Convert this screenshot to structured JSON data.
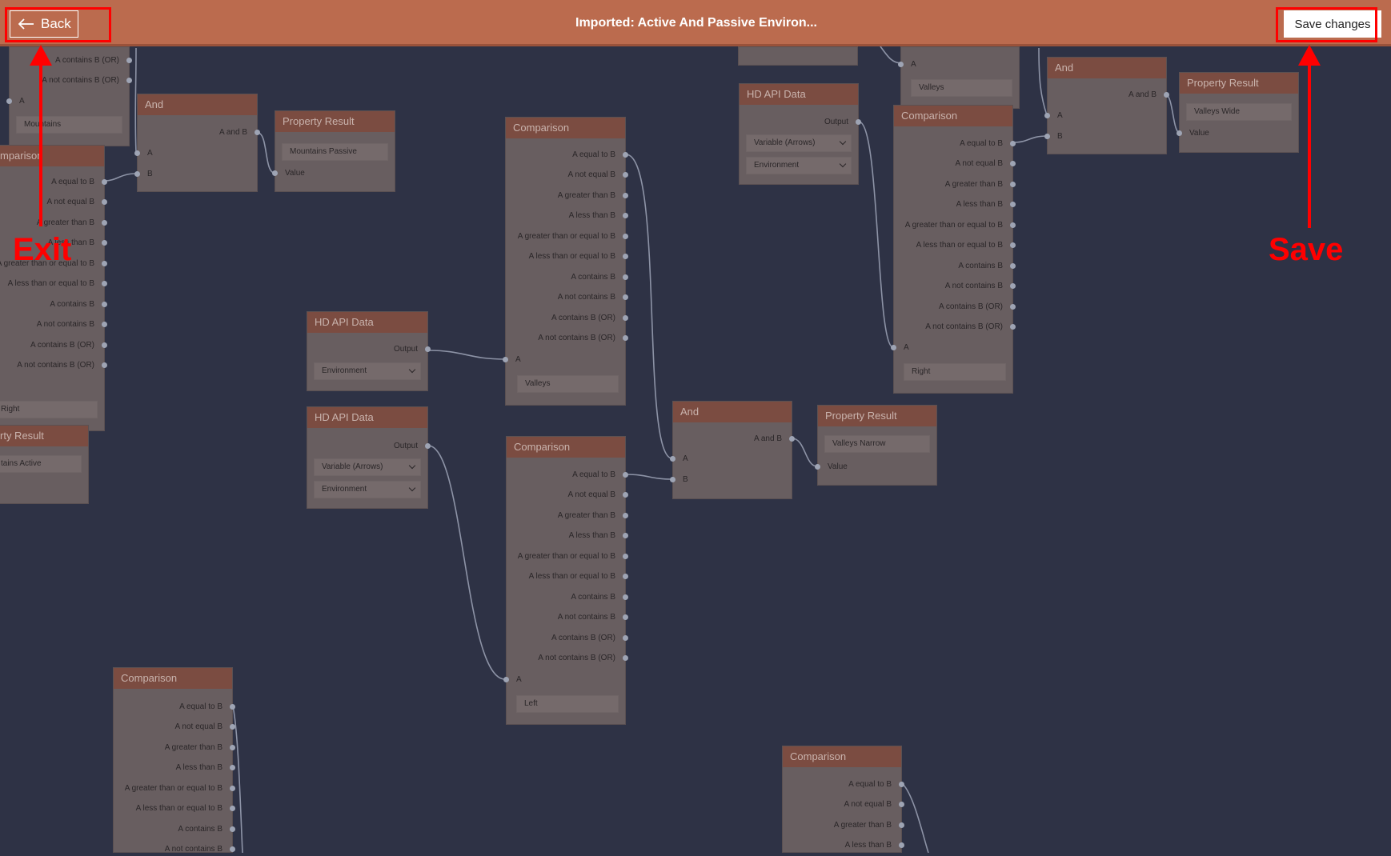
{
  "header": {
    "back_label": "Back",
    "title": "Imported: Active And Passive Environ...",
    "save_label": "Save changes",
    "bar_color": "#bb6b4e"
  },
  "annotations": {
    "exit": "Exit",
    "save": "Save",
    "color": "#ff0000"
  },
  "comparison_outputs": [
    "A equal to B",
    "A not equal B",
    "A greater than B",
    "A less than B",
    "A greater than or equal to B",
    "A less than or equal to B",
    "A contains B",
    "A not contains B",
    "A contains B (OR)",
    "A not contains B (OR)"
  ],
  "labels": {
    "comparison": "Comparison",
    "and": "And",
    "property_result": "Property Result",
    "hd_api_data": "HD API Data",
    "input_a": "A",
    "input_b": "B",
    "a_and_b": "A and B",
    "value": "Value",
    "output": "Output"
  },
  "values": {
    "mountains": "Mountains",
    "mountains_passive": "Mountains Passive",
    "mountains_active_partial": "tains Active",
    "property_result_partial": "rty Result",
    "comparison_partial": "mparison",
    "valleys": "Valleys",
    "valleys_wide": "Valleys Wide",
    "valleys_narrow": "Valleys Narrow",
    "environment": "Environment",
    "variable_arrows": "Variable (Arrows)",
    "right": "Right",
    "left": "Left"
  }
}
